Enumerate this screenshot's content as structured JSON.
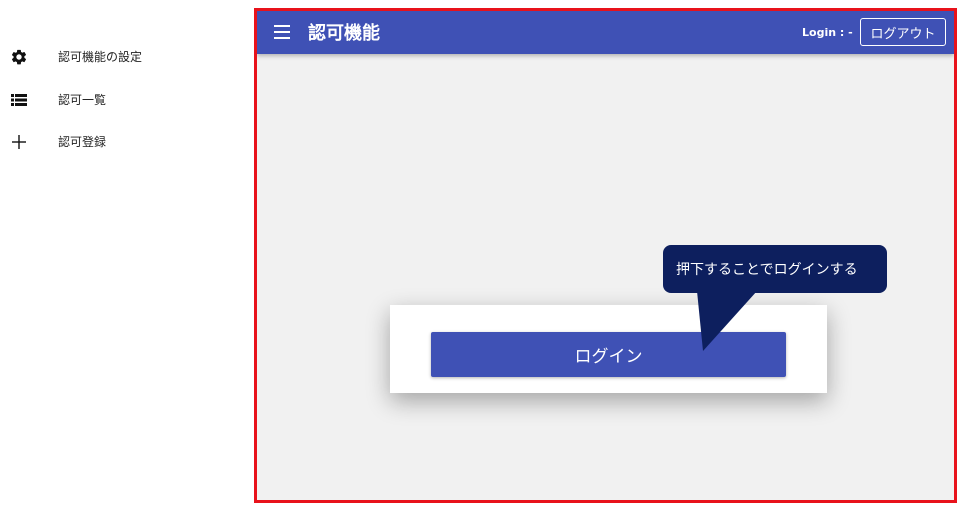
{
  "sidebar": {
    "items": [
      {
        "label": "認可機能の設定",
        "icon": "gear-icon"
      },
      {
        "label": "認可一覧",
        "icon": "list-icon"
      },
      {
        "label": "認可登録",
        "icon": "plus-icon"
      }
    ]
  },
  "app_bar": {
    "title": "認可機能",
    "login_status": "Login : -",
    "logout_label": "ログアウト"
  },
  "card": {
    "login_label": "ログイン"
  },
  "callout": {
    "text": "押下することでログインする"
  },
  "colors": {
    "primary": "#3f51b5",
    "frame_border": "#e8121b",
    "callout_bg": "#0d1f5e",
    "content_bg": "#f1f1f1"
  }
}
